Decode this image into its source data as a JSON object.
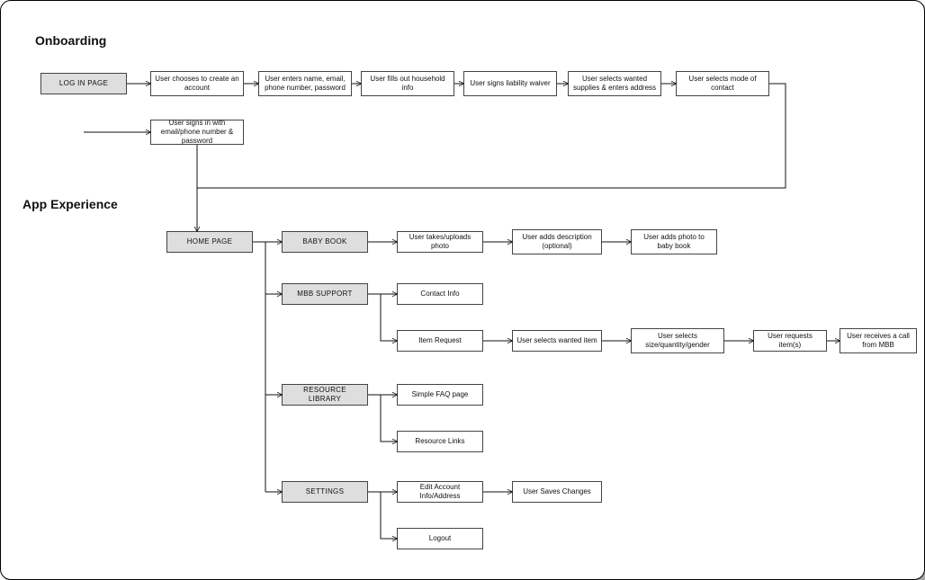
{
  "sections": {
    "onboarding_title": "Onboarding",
    "app_experience_title": "App Experience"
  },
  "onboarding": {
    "login_page": "LOG IN PAGE",
    "create_account": "User chooses to create an account",
    "enter_details": "User enters name, email, phone number, password",
    "household_info": "User fills out household info",
    "liability_waiver": "User signs liability waiver",
    "supplies_address": "User selects wanted supplies & enters address",
    "mode_of_contact": "User selects mode of contact",
    "signin": "User signs in with email/phone number & password"
  },
  "app": {
    "home_page": "HOME PAGE",
    "baby_book": {
      "label": "BABY BOOK",
      "take_photo": "User takes/uploads photo",
      "description": "User adds description (optional)",
      "add_to_book": "User adds photo to baby book"
    },
    "mbb_support": {
      "label": "MBB SUPPORT",
      "contact_info": "Contact Info",
      "item_request": "Item Request",
      "select_item": "User selects wanted item",
      "select_sqg": "User selects size/quantity/gender",
      "request_items": "User requests item(s)",
      "call_mbb": "User receives a call from MBB"
    },
    "resource_library": {
      "label": "RESOURCE LIBRARY",
      "faq": "Simple FAQ page",
      "links": "Resource Links"
    },
    "settings": {
      "label": "SETTINGS",
      "edit_account": "Edit Account Info/Address",
      "save_changes": "User Saves Changes",
      "logout": "Logout"
    }
  }
}
